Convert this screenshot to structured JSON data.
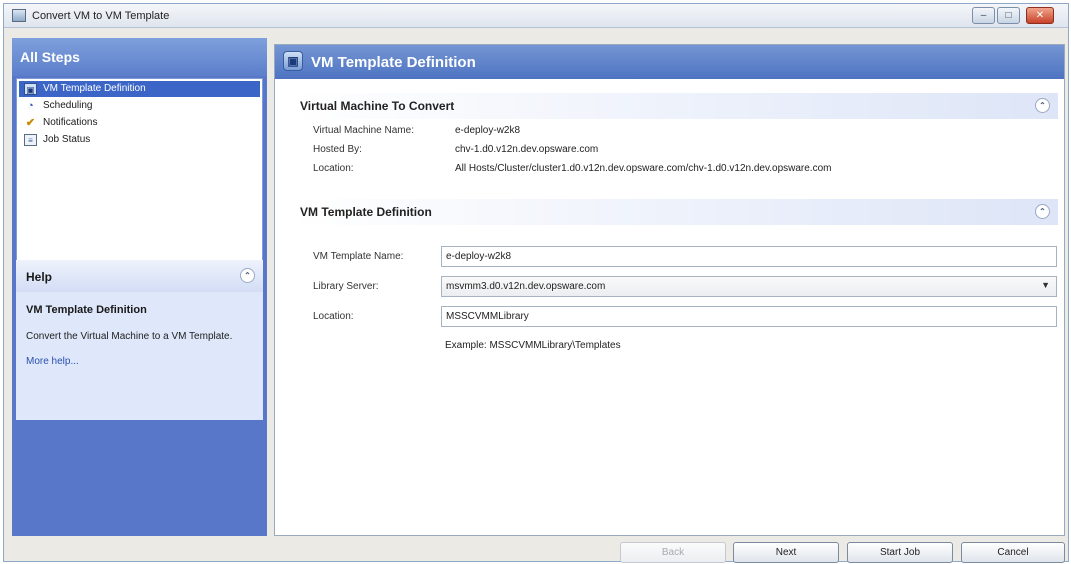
{
  "window": {
    "title": "Convert VM to VM Template",
    "minimize": "–",
    "maximize": "□",
    "close": "✕"
  },
  "sidebar": {
    "title": "All Steps",
    "steps": [
      {
        "label": "VM Template Definition",
        "icon": "template-icon",
        "active": true
      },
      {
        "label": "Scheduling",
        "icon": "clock-icon",
        "active": false
      },
      {
        "label": "Notifications",
        "icon": "checkmark-icon",
        "active": false
      },
      {
        "label": "Job Status",
        "icon": "document-icon",
        "active": false
      }
    ]
  },
  "help": {
    "title": "Help",
    "heading": "VM Template Definition",
    "description": "Convert the Virtual Machine to a VM Template.",
    "link": "More help..."
  },
  "main": {
    "title": "VM Template Definition",
    "vm_section": {
      "title": "Virtual Machine To Convert",
      "rows": [
        {
          "label": "Virtual Machine Name:",
          "value": "e-deploy-w2k8"
        },
        {
          "label": "Hosted By:",
          "value": "chv-1.d0.v12n.dev.opsware.com"
        },
        {
          "label": "Location:",
          "value": "All Hosts/Cluster/cluster1.d0.v12n.dev.opsware.com/chv-1.d0.v12n.dev.opsware.com"
        }
      ]
    },
    "template_section": {
      "title": "VM Template Definition",
      "name_label": "VM Template Name:",
      "name_value": "e-deploy-w2k8",
      "server_label": "Library Server:",
      "server_value": "msvmm3.d0.v12n.dev.opsware.com",
      "location_label": "Location:",
      "location_value": "MSSCVMMLibrary",
      "example": "Example: MSSCVMMLibrary\\Templates"
    }
  },
  "footer": {
    "back": "Back",
    "next": "Next",
    "start": "Start Job",
    "cancel": "Cancel"
  }
}
